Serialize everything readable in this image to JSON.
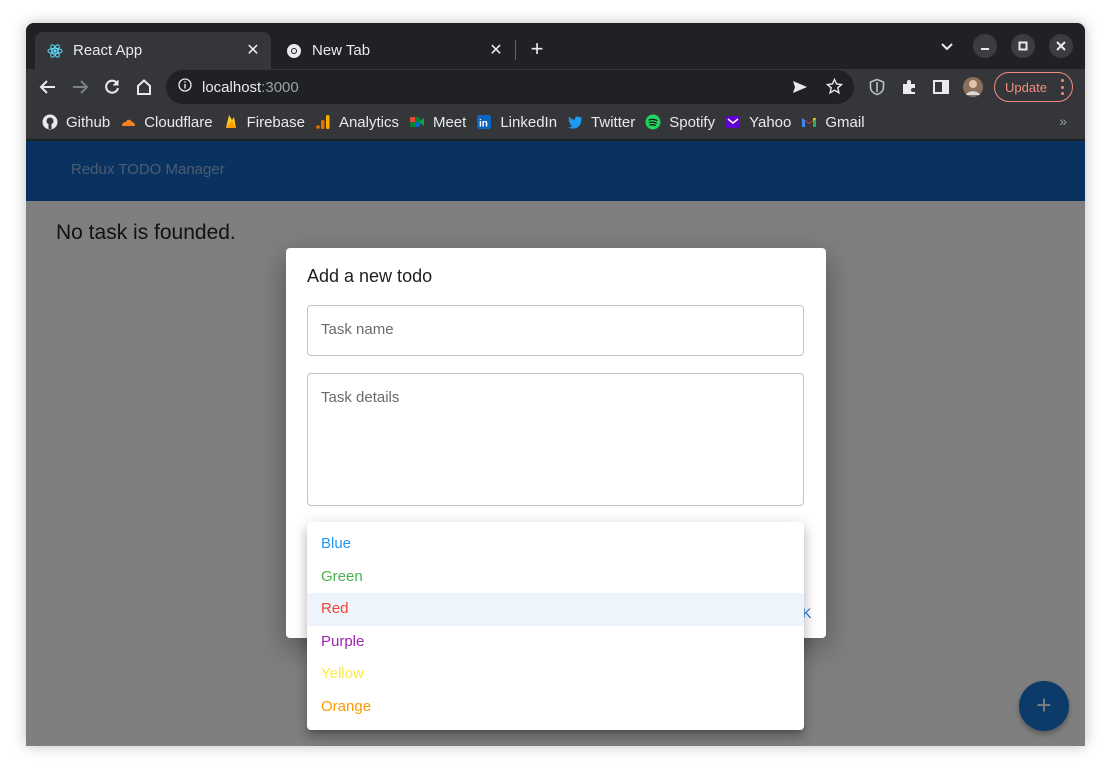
{
  "browser": {
    "tabs": [
      {
        "title": "React App",
        "icon": "react-icon",
        "active": true
      },
      {
        "title": "New Tab",
        "icon": "chrome-icon",
        "active": false
      }
    ],
    "address": {
      "host": "localhost",
      "port": ":3000"
    },
    "update_label": "Update",
    "bookmarks": [
      {
        "label": "Github",
        "icon": "github-icon"
      },
      {
        "label": "Cloudflare",
        "icon": "cloudflare-icon"
      },
      {
        "label": "Firebase",
        "icon": "firebase-icon"
      },
      {
        "label": "Analytics",
        "icon": "analytics-icon"
      },
      {
        "label": "Meet",
        "icon": "meet-icon"
      },
      {
        "label": "LinkedIn",
        "icon": "linkedin-icon"
      },
      {
        "label": "Twitter",
        "icon": "twitter-icon"
      },
      {
        "label": "Spotify",
        "icon": "spotify-icon"
      },
      {
        "label": "Yahoo",
        "icon": "yahoo-icon"
      },
      {
        "label": "Gmail",
        "icon": "gmail-icon"
      }
    ],
    "bookmarks_more": "»"
  },
  "app": {
    "brand": "Redux TODO Manager",
    "empty_message": "No task is founded.",
    "fab_label": "+",
    "accent_color": "#1565c0"
  },
  "dialog": {
    "title": "Add a new todo",
    "task_name_placeholder": "Task name",
    "task_details_placeholder": "Task details",
    "ok_label": "K",
    "color_options": [
      {
        "label": "Blue",
        "color": "#2196f3",
        "selected": false
      },
      {
        "label": "Green",
        "color": "#4caf50",
        "selected": false
      },
      {
        "label": "Red",
        "color": "#f44336",
        "selected": true
      },
      {
        "label": "Purple",
        "color": "#9c27b0",
        "selected": false
      },
      {
        "label": "Yellow",
        "color": "#ffeb3b",
        "selected": false
      },
      {
        "label": "Orange",
        "color": "#ff9800",
        "selected": false
      }
    ]
  }
}
